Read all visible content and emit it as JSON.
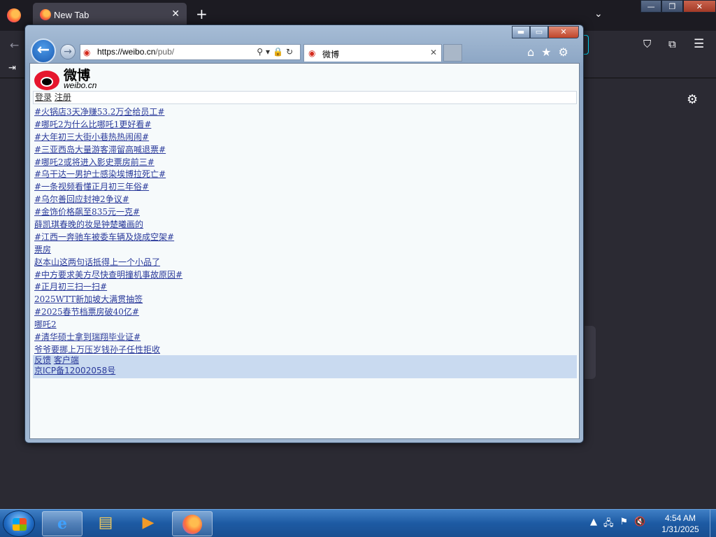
{
  "firefox": {
    "tab_title": "New Tab",
    "tab_close": "✕",
    "new_tab": "+",
    "list_tabs": "⌄",
    "win_min": "—",
    "win_restore": "❐",
    "win_close": "✕",
    "back": "←",
    "pocket": "⛉",
    "extensions": "⧉",
    "menu": "☰",
    "import": "⇥",
    "settings": "⚙"
  },
  "ie": {
    "caption_min": "▬",
    "caption_max": "▭",
    "caption_close": "✕",
    "back_glyph": "←",
    "forward_glyph": "→",
    "url_host": "https://weibo.cn",
    "url_path": "/pub/",
    "address_tools": "⚲▾🔒↻",
    "tab_title": "微博",
    "tab_close": "✕",
    "home": "⌂",
    "favorites": "★",
    "tools": "⚙"
  },
  "page": {
    "logo_cn": "微博",
    "logo_en": "weibo.cn",
    "login": "登录",
    "register": "注册",
    "topics": [
      "#火锅店3天净赚53.2万全给员工#",
      "#哪吒2为什么比哪吒1更好看#",
      "#大年初三大街小巷热热闹闹#",
      "#三亚西岛大量游客滞留高喊退票#",
      "#哪吒2或将进入影史票房前三#",
      "#乌干达一男护士感染埃博拉死亡#",
      "#一条视频看懂正月初三年俗#",
      "#乌尔善回应封神2争议#",
      "#金饰价格飙至835元一克#",
      "薛凯琪春晚的妆是钟楚曦画的",
      "#江西一奔驰车被委车辆及烧成空架#",
      "票房",
      "赵本山这两句话抵得上一个小品了",
      "#中方要求美方尽快查明撞机事故原因#",
      "#正月初三扫一扫#",
      "2025WTT新加坡大满贯抽签",
      "#2025春节档票房破40亿#",
      "哪吒2",
      "#清华硕士拿到瑞翔毕业证#",
      "爷爷要挪上万压岁钱孙子任性拒收"
    ],
    "feedback": "反馈",
    "client": "客户端",
    "icp": "京ICP备12002058号"
  },
  "taskbar": {
    "ie_glyph": "e",
    "explorer_glyph": "▤",
    "media_glyph": "▶",
    "tray_arrow": "▲",
    "tray_network": "🖧",
    "tray_flag": "⚑",
    "tray_volume": "🔇",
    "time": "4:54 AM",
    "date": "1/31/2025"
  }
}
